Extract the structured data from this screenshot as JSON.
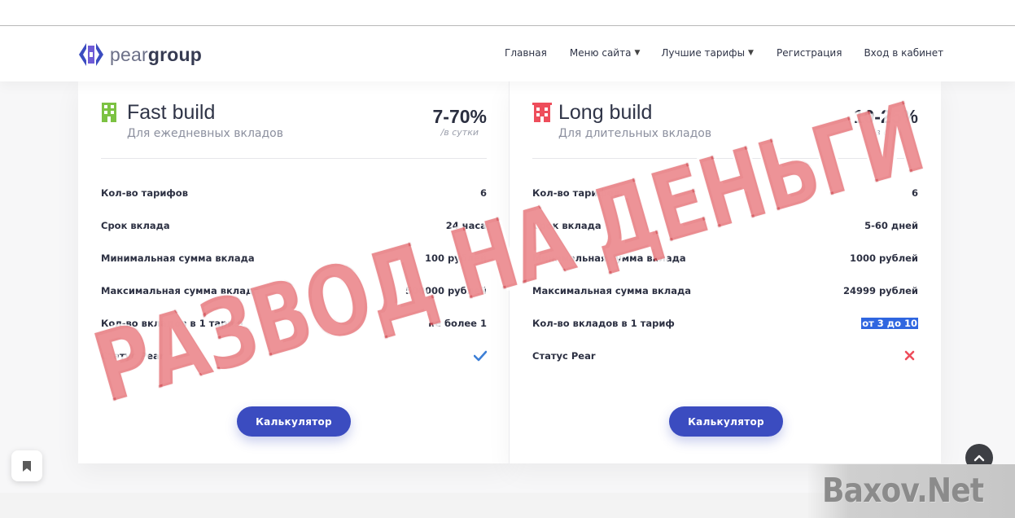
{
  "brand": {
    "name_light": "pear",
    "name_bold": "group"
  },
  "nav": [
    {
      "label": "Главная",
      "dropdown": false
    },
    {
      "label": "Меню сайта",
      "dropdown": true
    },
    {
      "label": "Лучшие тарифы",
      "dropdown": true
    },
    {
      "label": "Регистрация",
      "dropdown": false
    },
    {
      "label": "Вход в кабинет",
      "dropdown": false
    }
  ],
  "cards": [
    {
      "title": "Fast build",
      "subtitle": "Для ежедневных вкладов",
      "rate": "7-70%",
      "rate_unit": "/в сутки",
      "icon_color": "#7cc242",
      "rows": [
        {
          "label": "Кол-во тарифов",
          "value": "6"
        },
        {
          "label": "Срок вклада",
          "value": "24 часа"
        },
        {
          "label": "Минимальная сумма вклада",
          "value": "100 рублей"
        },
        {
          "label": "Максимальная сумма вклада",
          "value": "500000 рублей"
        },
        {
          "label": "Кол-во вкладов в 1 тариф",
          "value": "не более 1"
        },
        {
          "label": "Статус Pear",
          "value": "",
          "status": "yes"
        }
      ],
      "button": "Калькулятор"
    },
    {
      "title": "Long build",
      "subtitle": "Для длительных вкладов",
      "rate": "10-25%",
      "rate_unit": "/в сутки",
      "icon_color": "#ee4d5b",
      "rows": [
        {
          "label": "Кол-во тарифов",
          "value": "6"
        },
        {
          "label": "Срок вклада",
          "value": "5-60 дней"
        },
        {
          "label": "Минимальная сумма вклада",
          "value": "1000 рублей"
        },
        {
          "label": "Максимальная сумма вклада",
          "value": "24999 рублей"
        },
        {
          "label": "Кол-во вкладов в 1 тариф",
          "value": "от 3 до 10",
          "highlight": true
        },
        {
          "label": "Статус Pear",
          "value": "",
          "status": "no"
        }
      ],
      "button": "Калькулятор"
    }
  ],
  "overlay": {
    "stamp": "РАЗВОД НА ДЕНЬГИ",
    "watermark": "Baxov.Net"
  },
  "colors": {
    "accent": "#3b4cc0",
    "check": "#3d7fd6",
    "cross": "#ee4d5b",
    "stamp": "#e25258",
    "highlight": "#2f66e0"
  }
}
